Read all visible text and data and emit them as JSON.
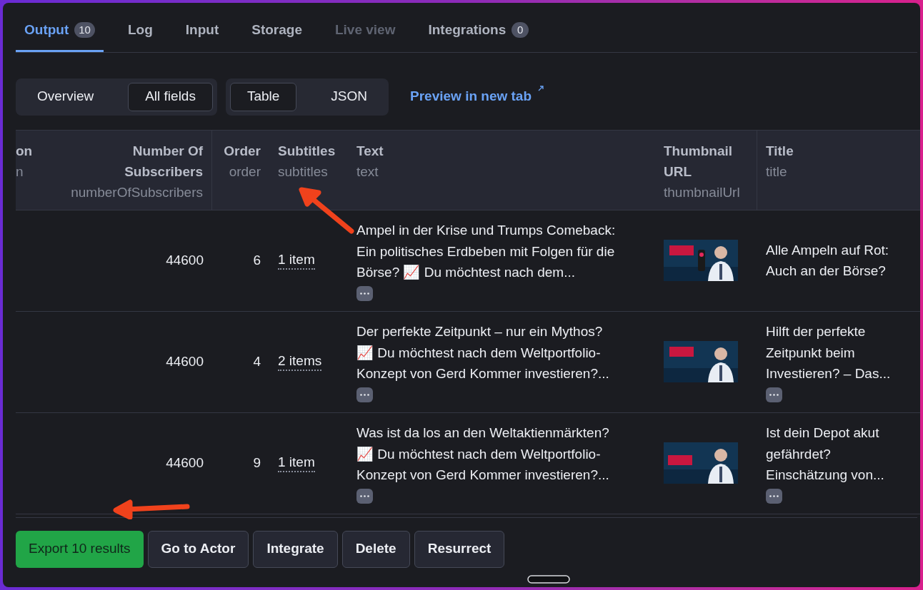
{
  "tabs": [
    {
      "label": "Output",
      "badge": "10",
      "selected": true,
      "disabled": false
    },
    {
      "label": "Log",
      "selected": false,
      "disabled": false
    },
    {
      "label": "Input",
      "selected": false,
      "disabled": false
    },
    {
      "label": "Storage",
      "selected": false,
      "disabled": false
    },
    {
      "label": "Live view",
      "selected": false,
      "disabled": true
    },
    {
      "label": "Integrations",
      "badge": "0",
      "selected": false,
      "disabled": false
    }
  ],
  "view_toggle": [
    {
      "label": "Overview",
      "selected": false
    },
    {
      "label": "All fields",
      "selected": true
    }
  ],
  "format_toggle": [
    {
      "label": "Table",
      "selected": true
    },
    {
      "label": "JSON",
      "selected": false
    }
  ],
  "preview_link": "Preview in new tab",
  "table": {
    "columns": [
      {
        "title": "on",
        "field": "n"
      },
      {
        "title": "Number Of Subscribers",
        "field": "numberOfSubscribers"
      },
      {
        "title": "Order",
        "field": "order"
      },
      {
        "title": "Subtitles",
        "field": "subtitles"
      },
      {
        "title": "Text",
        "field": "text"
      },
      {
        "title": "Thumbnail URL",
        "field": "thumbnailUrl"
      },
      {
        "title": "Title",
        "field": "title"
      }
    ],
    "rows": [
      {
        "subscribers": "44600",
        "order": "6",
        "subtitles": "1 item",
        "text": "Ampel in der Krise und Trumps Comeback: Ein politisches Erdbeben mit Folgen für die Börse? 📈 Du möchtest nach dem...",
        "text_more": true,
        "title": "Alle Ampeln auf Rot: Auch an der Börse?",
        "title_more": false
      },
      {
        "subscribers": "44600",
        "order": "4",
        "subtitles": "2 items",
        "text": "Der perfekte Zeitpunkt – nur ein Mythos? 📈 Du möchtest nach dem Weltportfolio-Konzept von Gerd Kommer investieren?...",
        "text_more": true,
        "title": "Hilft der perfekte Zeitpunkt beim Investieren? – Das...",
        "title_more": true
      },
      {
        "subscribers": "44600",
        "order": "9",
        "subtitles": "1 item",
        "text": "Was ist da los an den Weltaktienmärkten? 📈 Du möchtest nach dem Weltportfolio-Konzept von Gerd Kommer investieren?...",
        "text_more": true,
        "title": "Ist dein Depot akut gefährdet? Einschätzung von...",
        "title_more": true
      }
    ]
  },
  "actions": [
    {
      "label": "Export 10 results",
      "kind": "primary"
    },
    {
      "label": "Go to Actor",
      "kind": "secondary"
    },
    {
      "label": "Integrate",
      "kind": "secondary"
    },
    {
      "label": "Delete",
      "kind": "secondary"
    },
    {
      "label": "Resurrect",
      "kind": "secondary"
    }
  ]
}
